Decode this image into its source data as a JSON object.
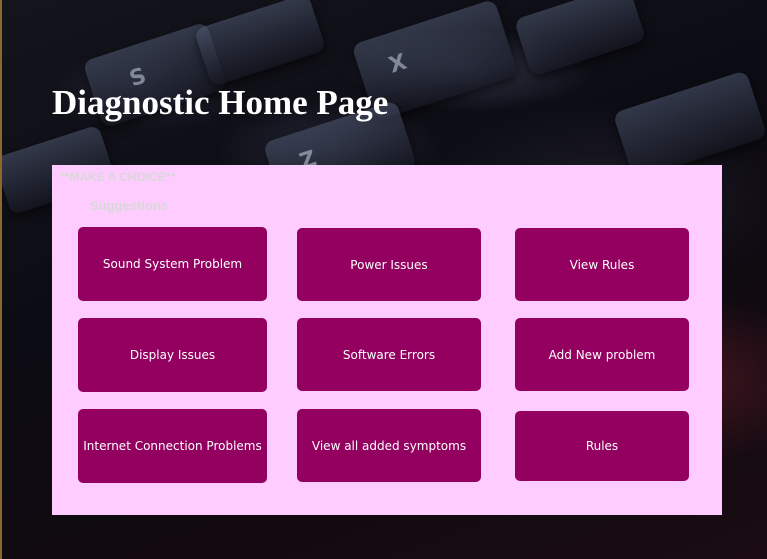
{
  "page": {
    "title": "Diagnostic Home Page"
  },
  "panel": {
    "header": "**MAKE A CHOICE**",
    "subheader": "Suggestions"
  },
  "buttons": {
    "sound_system_problem": "Sound System Problem",
    "power_issues": "Power Issues",
    "view_rules": "View Rules",
    "display_issues": "Display Issues",
    "software_errors": "Software Errors",
    "add_new_problem": "Add New problem",
    "internet_connection_problems": "Internet Connection Problems",
    "view_all_added_symptoms": "View all added symptoms",
    "rules": "Rules"
  },
  "colors": {
    "panel_background": "#ffccff",
    "button_background": "#930060",
    "button_text": "#ffffff",
    "title_text": "#ffffff"
  }
}
